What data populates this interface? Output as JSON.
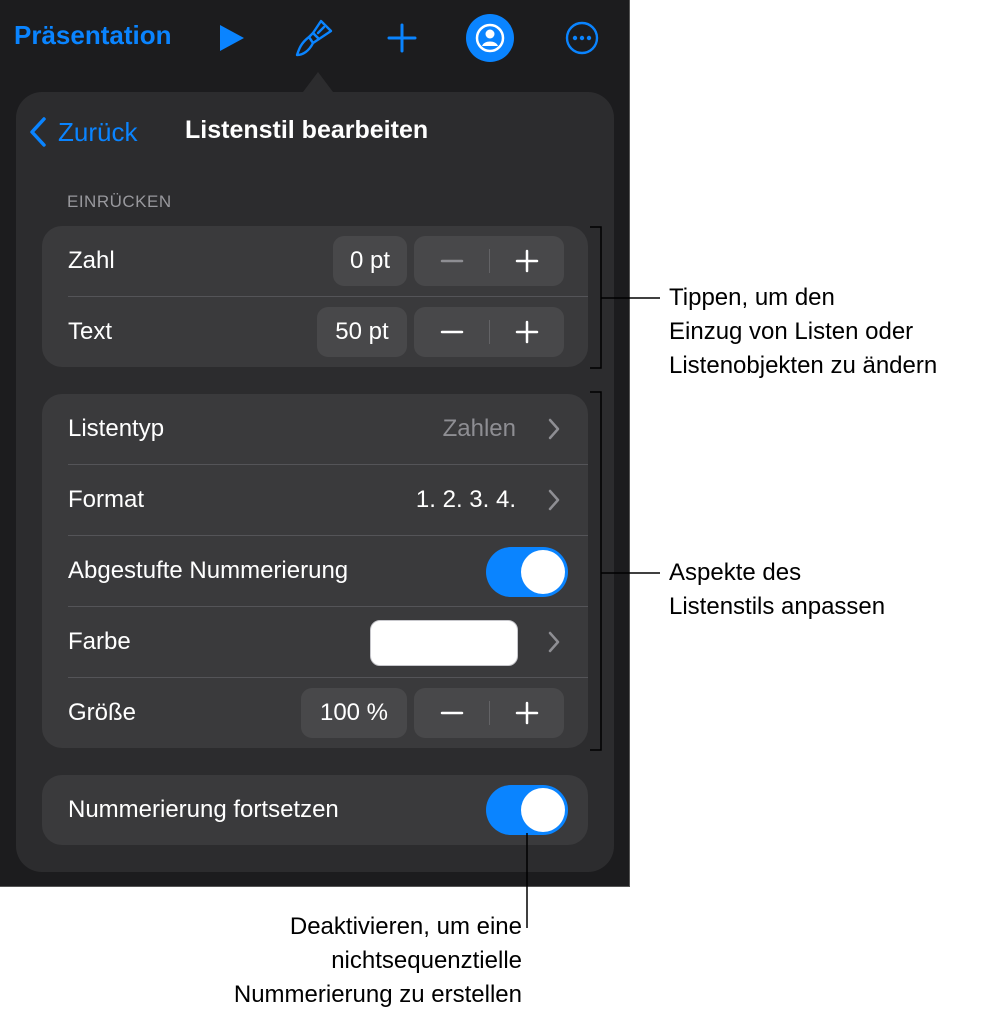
{
  "toolbar": {
    "title": "Präsentation",
    "icons": [
      "play-icon",
      "paintbrush-icon",
      "plus-icon",
      "collaborate-icon",
      "more-icon"
    ],
    "accent_color": "#0a84ff"
  },
  "panel": {
    "back_label": "Zurück",
    "title": "Listenstil bearbeiten"
  },
  "indent_section": {
    "header": "EINRÜCKEN",
    "rows": [
      {
        "label": "Zahl",
        "value": "0 pt"
      },
      {
        "label": "Text",
        "value": "50 pt"
      }
    ]
  },
  "style_section": {
    "list_type": {
      "label": "Listentyp",
      "value": "Zahlen"
    },
    "format": {
      "label": "Format",
      "value": "1. 2. 3. 4."
    },
    "tiered": {
      "label": "Abgestufte Nummerierung",
      "on": true
    },
    "color": {
      "label": "Farbe",
      "swatch": "#ffffff"
    },
    "size": {
      "label": "Größe",
      "value": "100 %"
    }
  },
  "continue_section": {
    "label": "Nummerierung fortsetzen",
    "on": true
  },
  "callouts": {
    "indent": [
      "Tippen, um den",
      "Einzug von Listen oder",
      "Listenobjekten zu ändern"
    ],
    "style": [
      "Aspekte des",
      "Listenstils anpassen"
    ],
    "continue": [
      "Deaktivieren, um eine",
      "nichtsequenztielle",
      "Nummerierung zu erstellen"
    ]
  }
}
